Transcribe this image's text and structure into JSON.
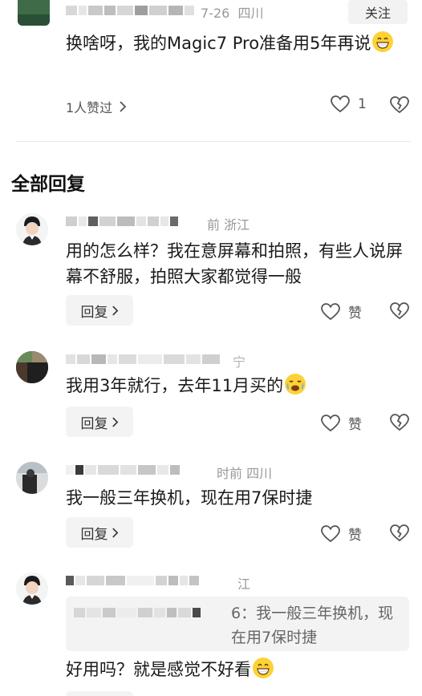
{
  "top_comment": {
    "date": "7-26",
    "location": "四川",
    "follow_label": "关注",
    "text": "换啥呀，我的Magic7 Pro准备用5年再说",
    "likes_summary": "1人赞过",
    "like_count": "1"
  },
  "section_title": "全部回复",
  "replies": [
    {
      "meta_visible": "前  浙江",
      "text": "用的怎么样？我在意屏幕和拍照，有些人说屏幕不舒服，拍照大家都觉得一般",
      "reply_label": "回复",
      "like_label": "赞"
    },
    {
      "meta_visible": "宁",
      "text": "我用3年就行，去年11月买的",
      "reply_label": "回复",
      "like_label": "赞"
    },
    {
      "meta_visible": "时前  四川",
      "text": "我一般三年换机，现在用7保时捷",
      "reply_label": "回复",
      "like_label": "赞"
    },
    {
      "meta_visible": "江",
      "quote": "6：我一般三年换机，现在用7保时捷",
      "text": "好用吗？就是感觉不好看"
    }
  ],
  "icons": {
    "chevron": "chevron-right-icon",
    "heart": "heart-icon",
    "dislike": "broken-heart-icon",
    "emoji_grin": "grinning-emoji",
    "emoji_cry": "crying-laughing-emoji"
  },
  "colors": {
    "meta": "#999999",
    "button_bg": "#f3f3f3",
    "emoji": "#fcd236"
  }
}
